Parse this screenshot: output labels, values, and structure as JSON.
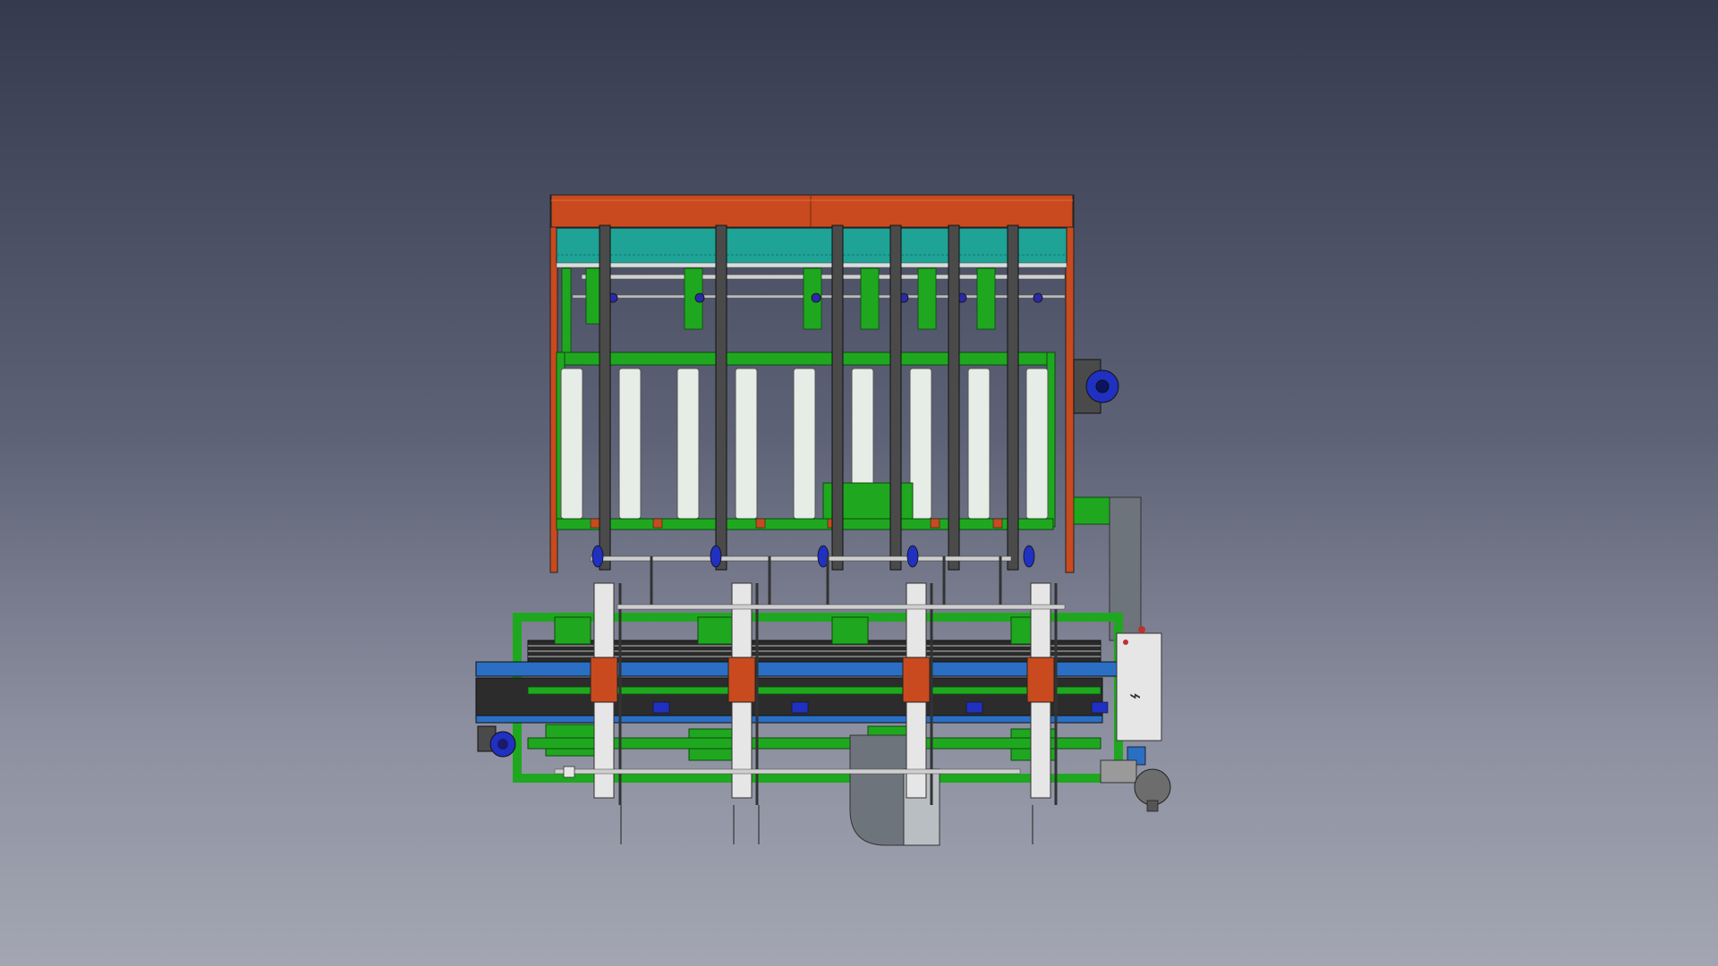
{
  "viewport": {
    "background_top": "#353a4e",
    "background_bottom": "#a3a6b2"
  },
  "model": {
    "colors": {
      "frame_orange": "#c84a1e",
      "panel_teal": "#1fa396",
      "frame_green": "#1fa81f",
      "bar_dark": "#4a4a4a",
      "roller_white": "#e6ece6",
      "belt_blue": "#2a6fc4",
      "motor_blue": "#2030c0",
      "cabinet_grey": "#e6e6e6",
      "duct_grey": "#6d747c"
    },
    "cabinet_symbol": "⌁"
  }
}
